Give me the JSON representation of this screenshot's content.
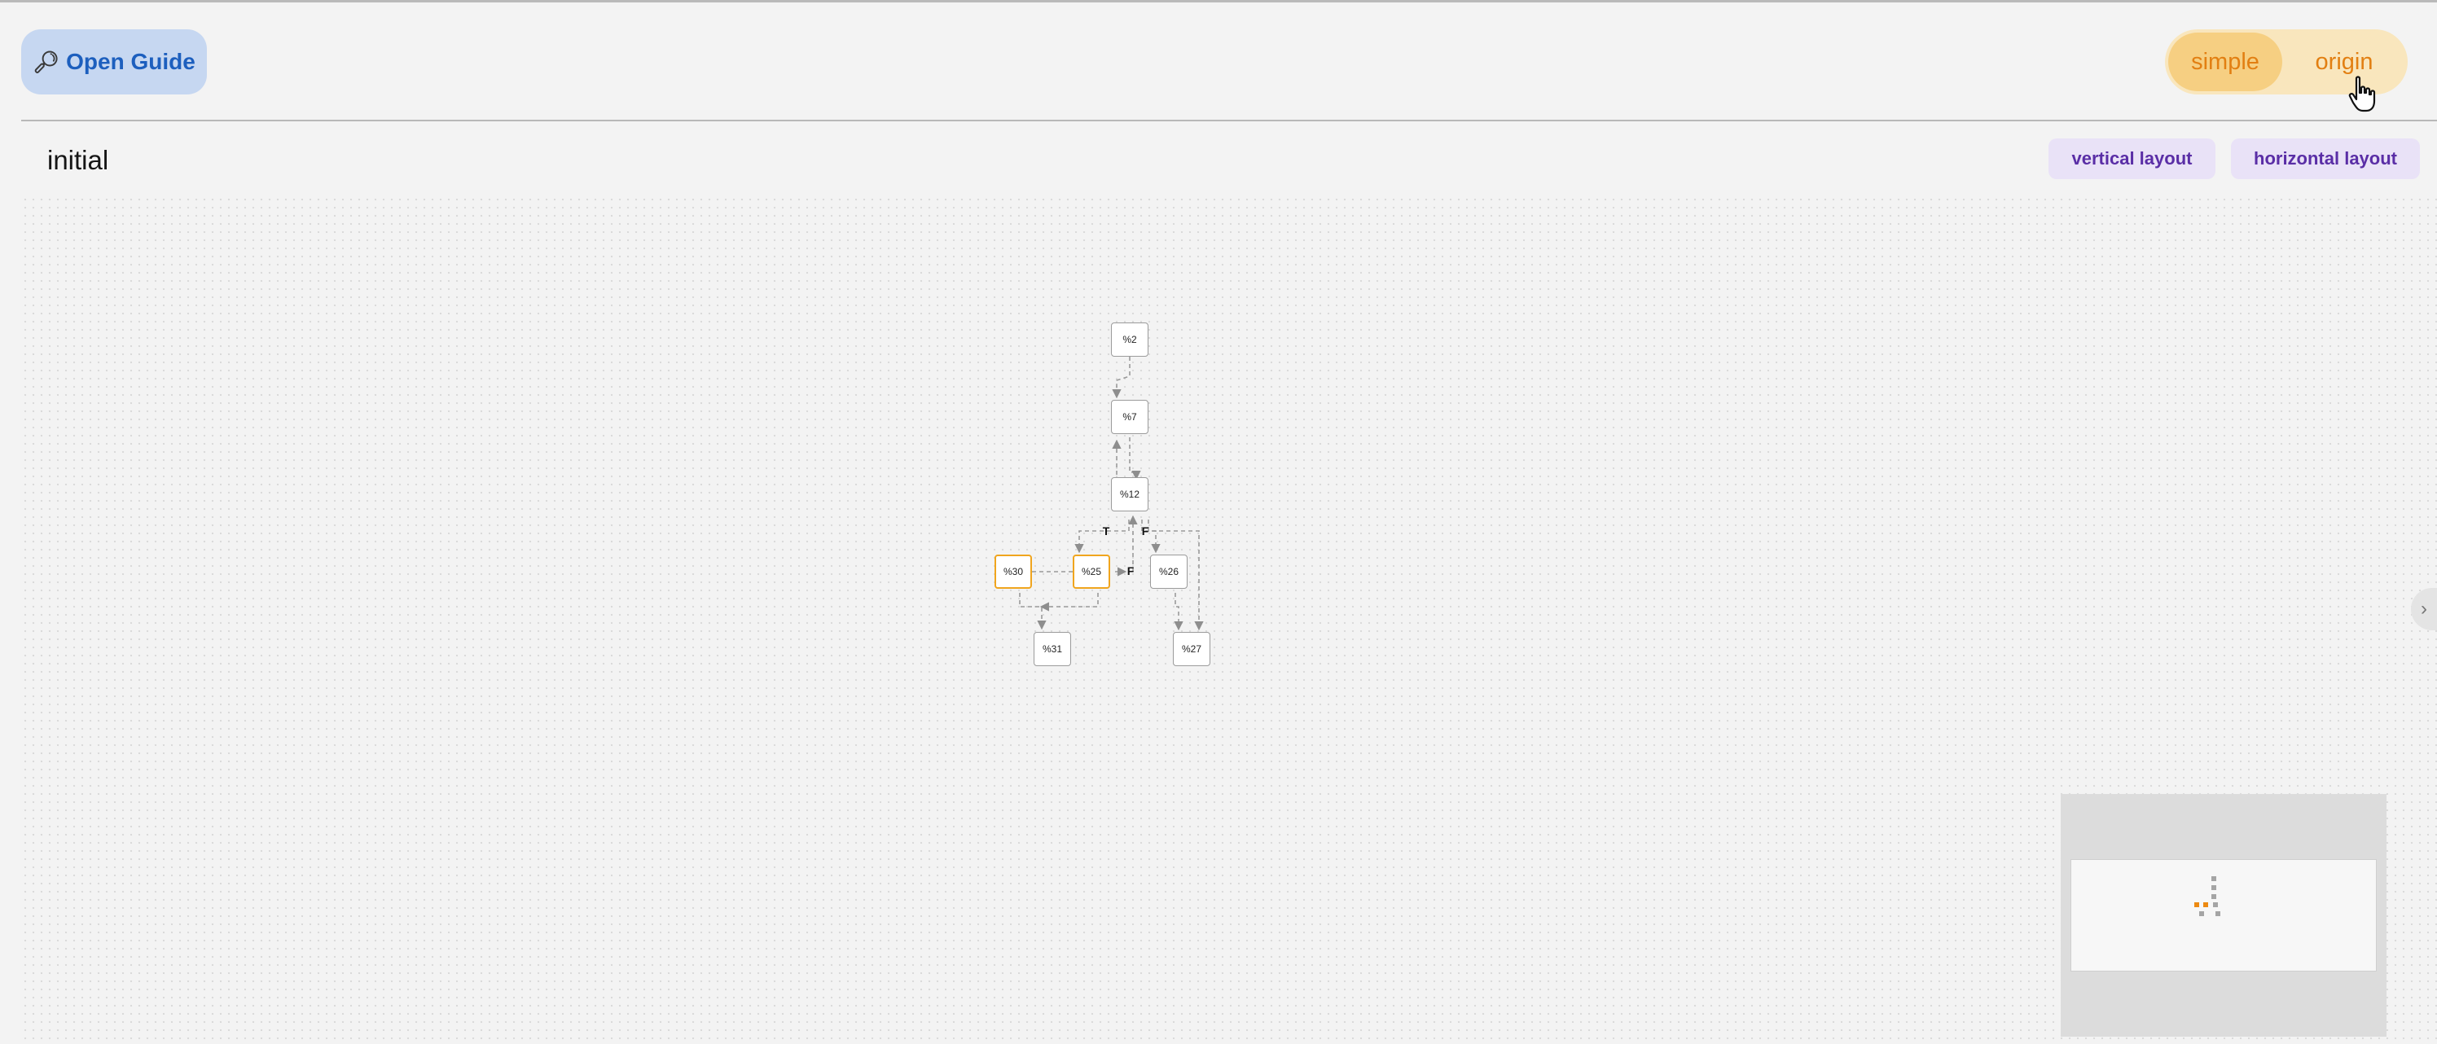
{
  "header": {
    "open_guide": {
      "icon": "magnifier-icon",
      "label": "Open Guide"
    },
    "mode": {
      "options": [
        "simple",
        "origin"
      ],
      "selected": "simple"
    }
  },
  "section": {
    "title": "initial",
    "vertical_layout_label": "vertical layout",
    "horizontal_layout_label": "horizontal layout"
  },
  "graph": {
    "nodes": [
      {
        "id": "%2",
        "highlighted": false
      },
      {
        "id": "%7",
        "highlighted": false
      },
      {
        "id": "%12",
        "highlighted": false
      },
      {
        "id": "%30",
        "highlighted": true
      },
      {
        "id": "%25",
        "highlighted": true
      },
      {
        "id": "%26",
        "highlighted": false
      },
      {
        "id": "%31",
        "highlighted": false
      },
      {
        "id": "%27",
        "highlighted": false
      }
    ],
    "edge_labels": [
      "T",
      "F",
      "F"
    ]
  },
  "colors": {
    "accent_orange": "#f0a51e",
    "guide_button": "#c6d7f1",
    "layout_button": "#e9e2f7"
  },
  "icons": {
    "side_handle": "chevron-right-icon",
    "cursor": "pointer-hand-icon"
  }
}
